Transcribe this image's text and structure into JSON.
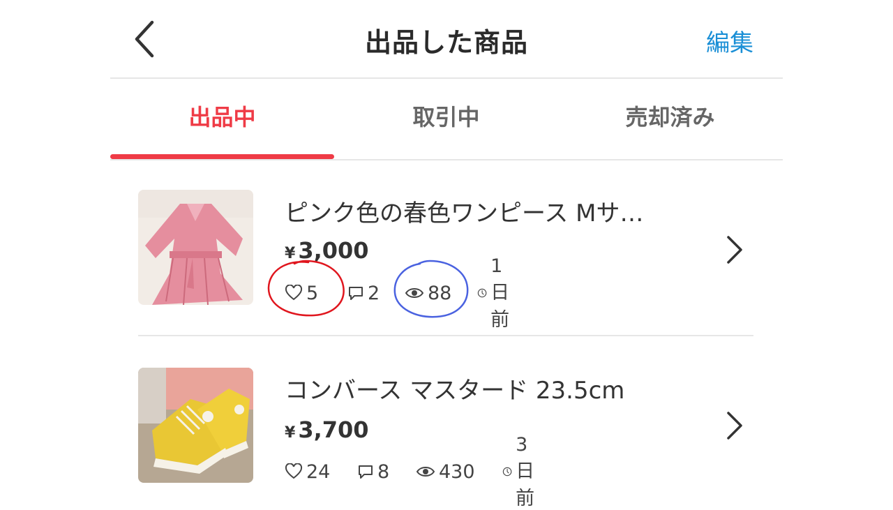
{
  "header": {
    "back_icon": "chevron-left-icon",
    "title": "出品した商品",
    "edit_label": "編集"
  },
  "tabs": [
    {
      "label": "出品中",
      "active": true
    },
    {
      "label": "取引中",
      "active": false
    },
    {
      "label": "売却済み",
      "active": false
    }
  ],
  "colors": {
    "accent": "#ef3b46",
    "link": "#1a8fd6",
    "annotation_red": "#e0161e",
    "annotation_blue": "#4a62e0"
  },
  "items": [
    {
      "title": "ピンク色の春色ワンピース Mサ…",
      "currency": "¥",
      "price": "3,000",
      "likes": "5",
      "comments": "2",
      "views": "88",
      "listed": "1日前"
    },
    {
      "title": "コンバース マスタード 23.5cm",
      "currency": "¥",
      "price": "3,700",
      "likes": "24",
      "comments": "8",
      "views": "430",
      "listed": "3日前"
    }
  ]
}
